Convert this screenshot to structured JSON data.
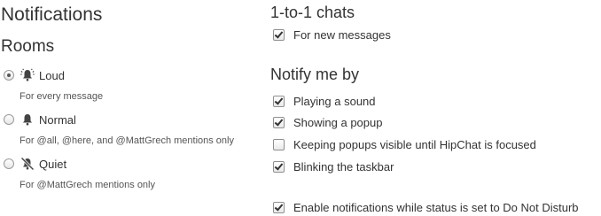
{
  "notifications": {
    "title": "Notifications",
    "rooms": {
      "heading": "Rooms",
      "options": [
        {
          "label": "Loud",
          "description": "For every message",
          "selected": true,
          "icon": "loud-bell-icon"
        },
        {
          "label": "Normal",
          "description": "For @all, @here, and @MattGrech mentions only",
          "selected": false,
          "icon": "bell-icon"
        },
        {
          "label": "Quiet",
          "description": "For @MattGrech mentions only",
          "selected": false,
          "icon": "muted-bell-icon"
        }
      ]
    },
    "one_to_one": {
      "heading": "1-to-1 chats",
      "options": [
        {
          "label": "For new messages",
          "checked": true
        }
      ]
    },
    "notify_me_by": {
      "heading": "Notify me by",
      "options": [
        {
          "label": "Playing a sound",
          "checked": true
        },
        {
          "label": "Showing a popup",
          "checked": true
        },
        {
          "label": "Keeping popups visible until HipChat is focused",
          "checked": false
        },
        {
          "label": "Blinking the taskbar",
          "checked": true
        }
      ]
    },
    "dnd": {
      "label": "Enable notifications while status is set to Do Not Disturb",
      "checked": true
    }
  }
}
